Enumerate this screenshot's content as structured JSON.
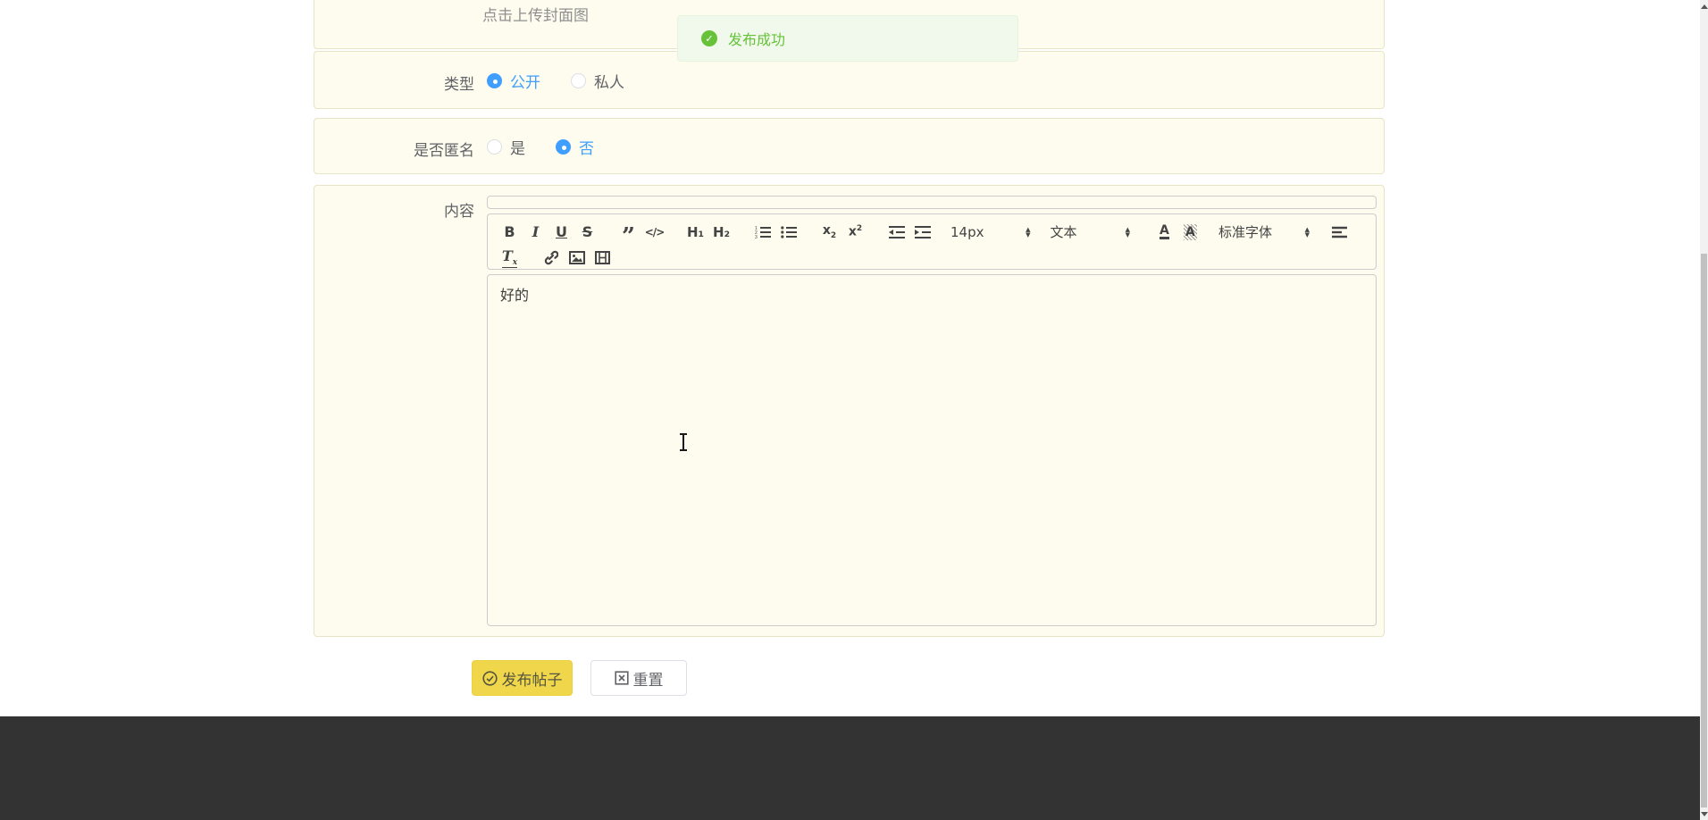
{
  "upload": {
    "hint": "点击上传封面图"
  },
  "toast": {
    "message": "发布成功"
  },
  "form": {
    "type": {
      "label": "类型",
      "options": [
        {
          "label": "公开",
          "selected": true
        },
        {
          "label": "私人",
          "selected": false
        }
      ]
    },
    "anonymous": {
      "label": "是否匿名",
      "options": [
        {
          "label": "是",
          "selected": false
        },
        {
          "label": "否",
          "selected": true
        }
      ]
    },
    "content": {
      "label": "内容",
      "value": "好的"
    }
  },
  "editor": {
    "toolbar": {
      "size_value": "14px",
      "style_value": "文本",
      "font_value": "标准字体",
      "icons": {
        "bold": "B",
        "italic": "I",
        "underline": "U",
        "strike": "S",
        "blockquote": "”",
        "code_block": "</>",
        "h1": "H₁",
        "h2": "H₂",
        "sub_x": "x",
        "sub_2": "2",
        "sup_x": "x",
        "sup_2": "2",
        "color_a": "A",
        "background_a": "A",
        "clean_t": "T",
        "clean_x": "x",
        "arrow_up": "▲",
        "arrow_down": "▼",
        "check": "✓"
      },
      "icon_names": [
        "bold",
        "italic",
        "underline",
        "strike",
        "blockquote",
        "code-block",
        "header-1",
        "header-2",
        "ordered-list",
        "bullet-list",
        "subscript",
        "superscript",
        "outdent",
        "indent",
        "size-picker",
        "style-picker",
        "text-color",
        "background-color",
        "font-picker",
        "align",
        "clean-format",
        "link",
        "image",
        "video"
      ]
    }
  },
  "actions": {
    "submit": "发布帖子",
    "reset": "重置"
  },
  "colors": {
    "accent_blue": "#409eff",
    "success_green": "#67c23a",
    "toast_bg": "#f0f9eb",
    "button_yellow": "#f0d64a",
    "section_bg": "#fdfcee",
    "section_border": "#e7e5c5",
    "footer": "#333333"
  }
}
